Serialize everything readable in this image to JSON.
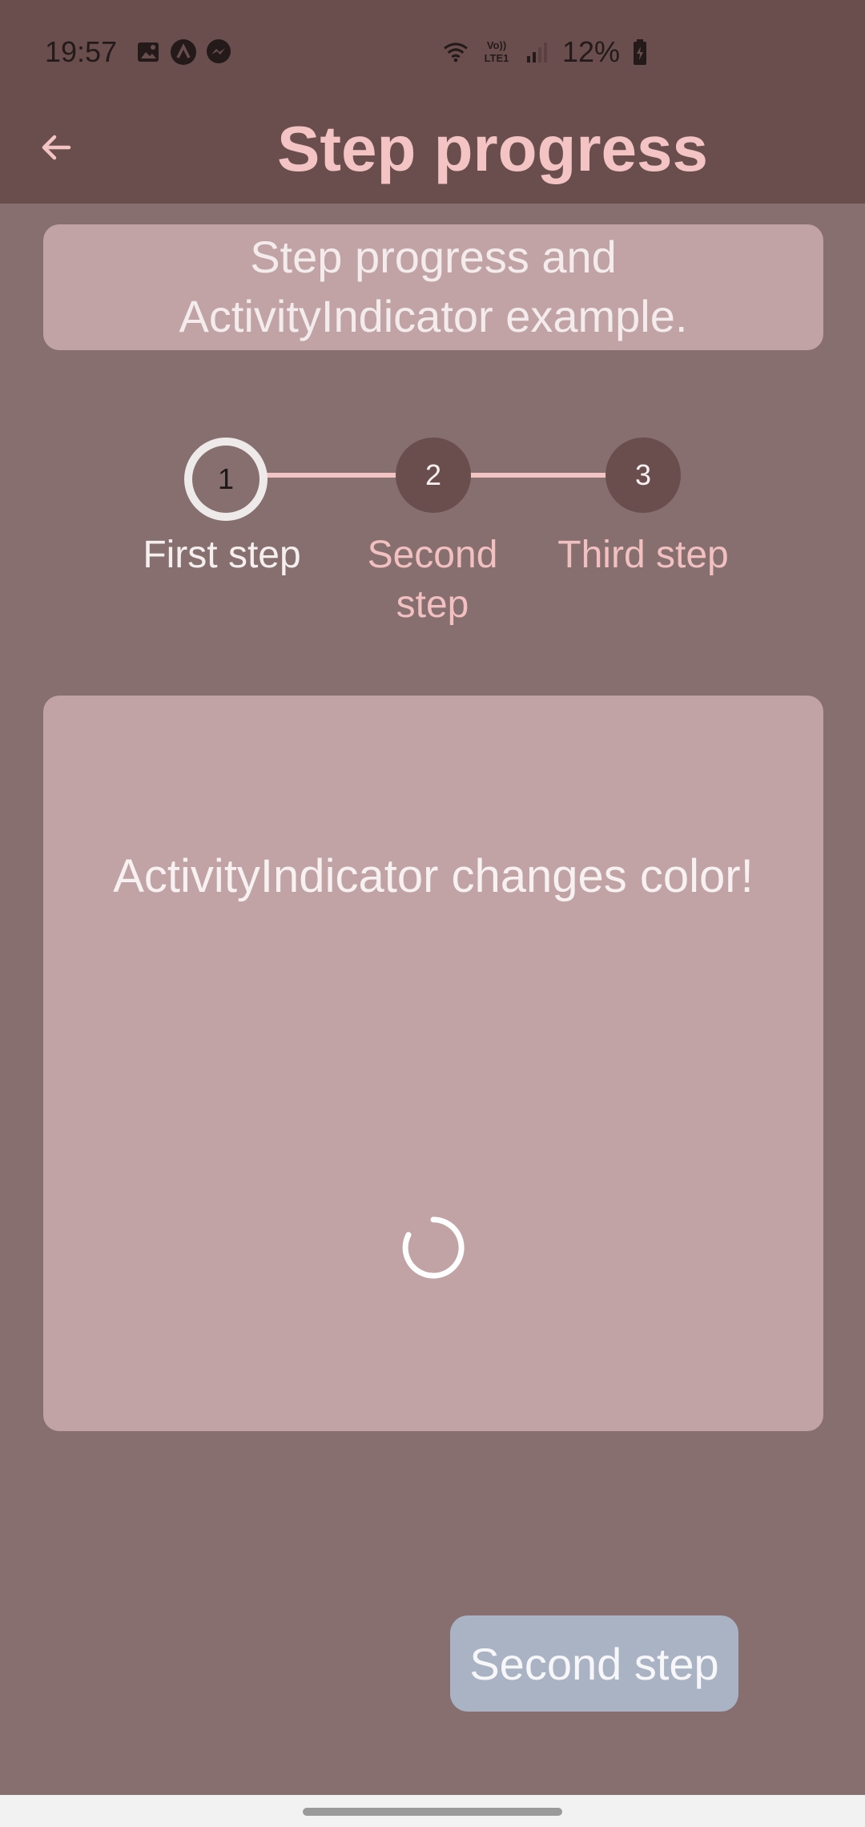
{
  "status_bar": {
    "time": "19:57",
    "icons_left": [
      "gallery-icon",
      "app-notification-icon",
      "messenger-icon"
    ],
    "icons_right": [
      "wifi-icon",
      "volte-icon",
      "signal-icon"
    ],
    "volte_label": "Vo))\nLTE1",
    "battery_text": "12%",
    "battery_icon": "battery-charging-icon"
  },
  "app_bar": {
    "title": "Step progress",
    "back_icon": "arrow-left-icon"
  },
  "intro": {
    "text_line1": "Step progress and",
    "text_line2": "ActivityIndicator example."
  },
  "stepper": {
    "steps": [
      {
        "number": "1",
        "label_line1": "First step",
        "label_line2": "",
        "state": "active"
      },
      {
        "number": "2",
        "label_line1": "Second",
        "label_line2": "step",
        "state": "inactive"
      },
      {
        "number": "3",
        "label_line1": "Third step",
        "label_line2": "",
        "state": "inactive"
      }
    ]
  },
  "content": {
    "message": "ActivityIndicator changes color!",
    "spinner_icon": "loading-spinner-icon"
  },
  "action_button": {
    "label": "Second step"
  },
  "colors": {
    "background": "#876f6f",
    "app_bar": "#6a4e4e",
    "card": "#c1a3a5",
    "accent": "#f4c4c4",
    "button": "#a9b3c3"
  }
}
